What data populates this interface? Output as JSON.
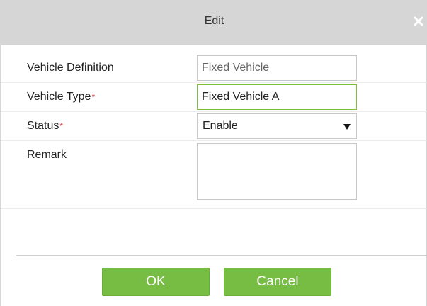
{
  "dialog": {
    "title": "Edit"
  },
  "form": {
    "vehicle_definition": {
      "label": "Vehicle Definition",
      "value": "Fixed Vehicle"
    },
    "vehicle_type": {
      "label": "Vehicle Type",
      "required_mark": "*",
      "value": "Fixed Vehicle A"
    },
    "status": {
      "label": "Status",
      "required_mark": "*",
      "selected": "Enable"
    },
    "remark": {
      "label": "Remark",
      "value": ""
    }
  },
  "footer": {
    "ok_label": "OK",
    "cancel_label": "Cancel"
  },
  "colors": {
    "accent_green": "#77bd44",
    "title_bar_gray": "#d6d6d6",
    "required_red": "#e23b3b",
    "focus_border": "#7cbf3b"
  },
  "icons": {
    "close": "close-icon",
    "dropdown": "triangle-down-icon"
  }
}
